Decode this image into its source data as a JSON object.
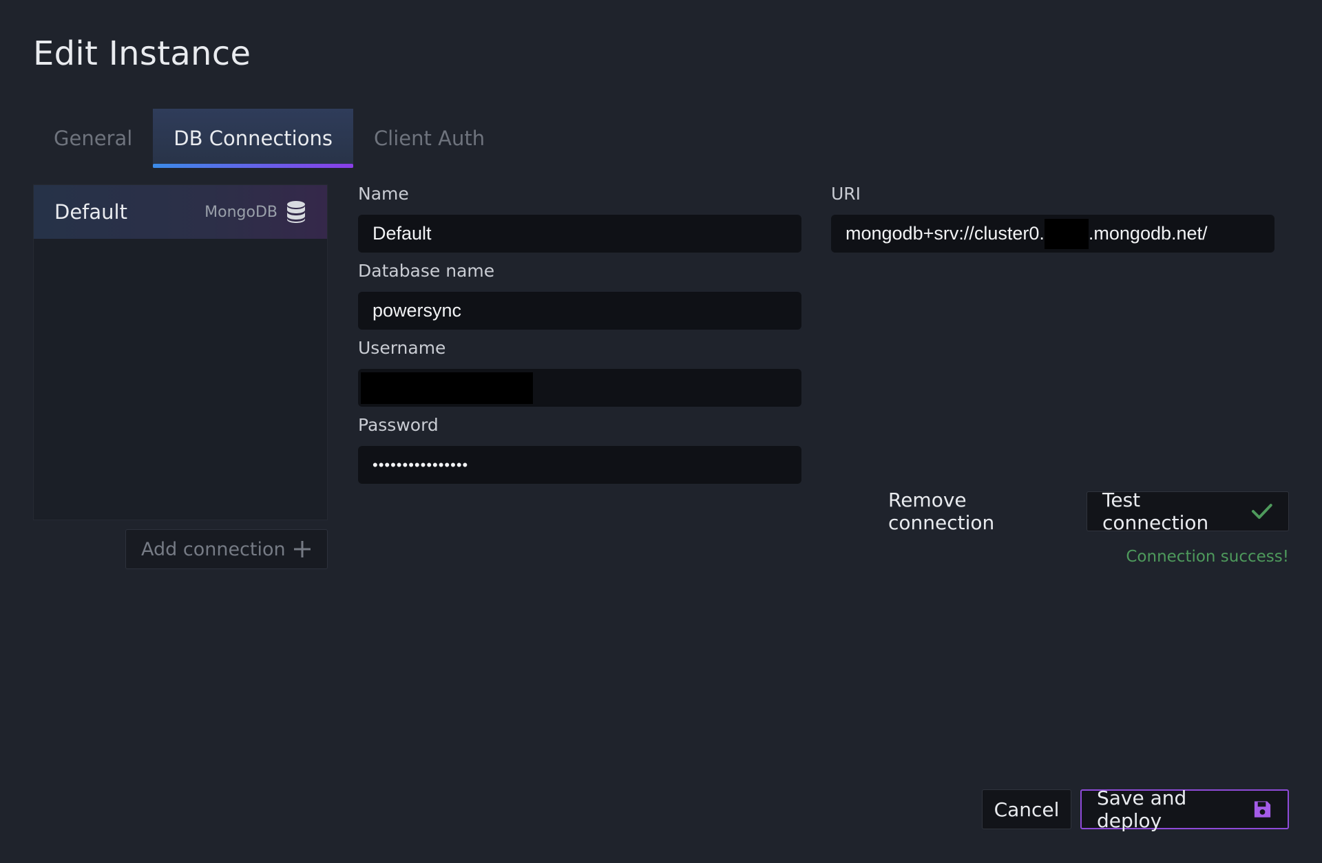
{
  "dialog": {
    "title": "Edit Instance"
  },
  "tabs": [
    {
      "label": "General",
      "active": false
    },
    {
      "label": "DB Connections",
      "active": true
    },
    {
      "label": "Client Auth",
      "active": false
    }
  ],
  "connections": {
    "items": [
      {
        "name": "Default",
        "type": "MongoDB",
        "icon": "database-icon"
      }
    ],
    "add_label": "Add connection",
    "add_icon": "plus-icon"
  },
  "form": {
    "name_label": "Name",
    "name_value": "Default",
    "uri_label": "URI",
    "uri_prefix": "mongodb+srv://cluster0.",
    "uri_suffix": ".mongodb.net/",
    "database_label": "Database name",
    "database_value": "powersync",
    "username_label": "Username",
    "password_label": "Password",
    "password_value": "••••••••••••••••"
  },
  "actions": {
    "remove_label": "Remove connection",
    "test_label": "Test connection",
    "test_icon": "check-icon",
    "status_text": "Connection success!",
    "status_color": "#4e9a5c",
    "cancel_label": "Cancel",
    "save_label": "Save and deploy",
    "save_icon": "floppy-disk-icon"
  },
  "colors": {
    "background": "#1f232c",
    "tab_accent_start": "#3b8be8",
    "tab_accent_end": "#8a3ee8",
    "save_border": "#8f4bd9"
  }
}
